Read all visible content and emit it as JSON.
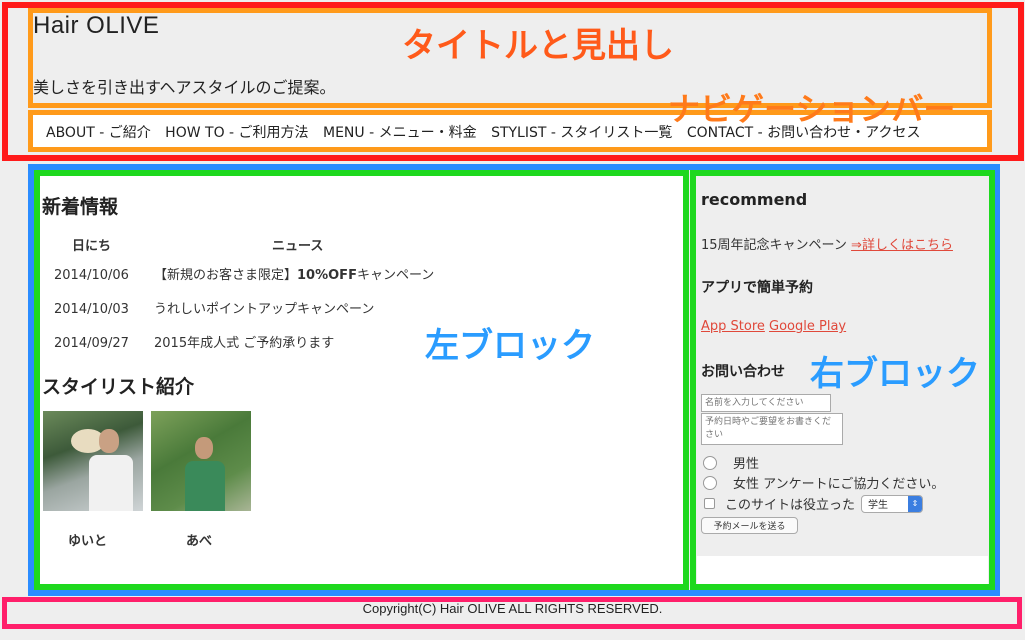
{
  "header": {
    "site_title": "Hair OLIVE",
    "tagline": "美しさを引き出すヘアスタイルのご提案。",
    "annotation_title": "タイトルと見出し",
    "annotation_nav": "ナビゲーションバー"
  },
  "nav": {
    "items": [
      {
        "label": "ABOUT - ご紹介"
      },
      {
        "label": "HOW TO - ご利用方法"
      },
      {
        "label": "MENU - メニュー・料金"
      },
      {
        "label": "STYLIST - スタイリスト一覧"
      },
      {
        "label": "CONTACT - お問い合わせ・アクセス"
      }
    ]
  },
  "left": {
    "annotation": "左ブロック",
    "news_heading": "新着情報",
    "col_date": "日にち",
    "col_news": "ニュース",
    "news": [
      {
        "date": "2014/10/06",
        "pre": "【新規のお客さま限定】",
        "bold": "10%OFF",
        "post": "キャンペーン"
      },
      {
        "date": "2014/10/03",
        "pre": "うれしいポイントアップキャンペーン",
        "bold": "",
        "post": ""
      },
      {
        "date": "2014/09/27",
        "pre": "2015年成人式 ご予約承ります",
        "bold": "",
        "post": ""
      }
    ],
    "stylist_heading": "スタイリスト紹介",
    "stylists": [
      {
        "name": "ゆいと"
      },
      {
        "name": "あべ"
      }
    ]
  },
  "right": {
    "annotation": "右ブロック",
    "recommend_heading": "recommend",
    "campaign_text": "15周年記念キャンペーン",
    "campaign_link": "⇒詳しくはこちら",
    "app_heading": "アプリで簡単予約",
    "app_store": "App Store",
    "google_play": "Google Play",
    "contact_heading": "お問い合わせ",
    "name_placeholder": "名前を入力してください",
    "message_placeholder": "予約日時やご要望をお書きください",
    "radio_male": "男性",
    "radio_female": "女性",
    "survey_text": "アンケートにご協力ください。",
    "checkbox_label": "このサイトは役立った",
    "select_value": "学生",
    "submit_label": "予約メールを送る"
  },
  "footer": {
    "copyright": "Copyright(C) Hair OLIVE ALL RIGHTS RESERVED."
  },
  "colors": {
    "header_frame": "#ff1a1a",
    "title_frame": "#ff9a1a",
    "main_frame": "#2a8cff",
    "block_frame": "#1ed81e",
    "footer_frame": "#ff1f6a",
    "link": "#e0483a"
  }
}
